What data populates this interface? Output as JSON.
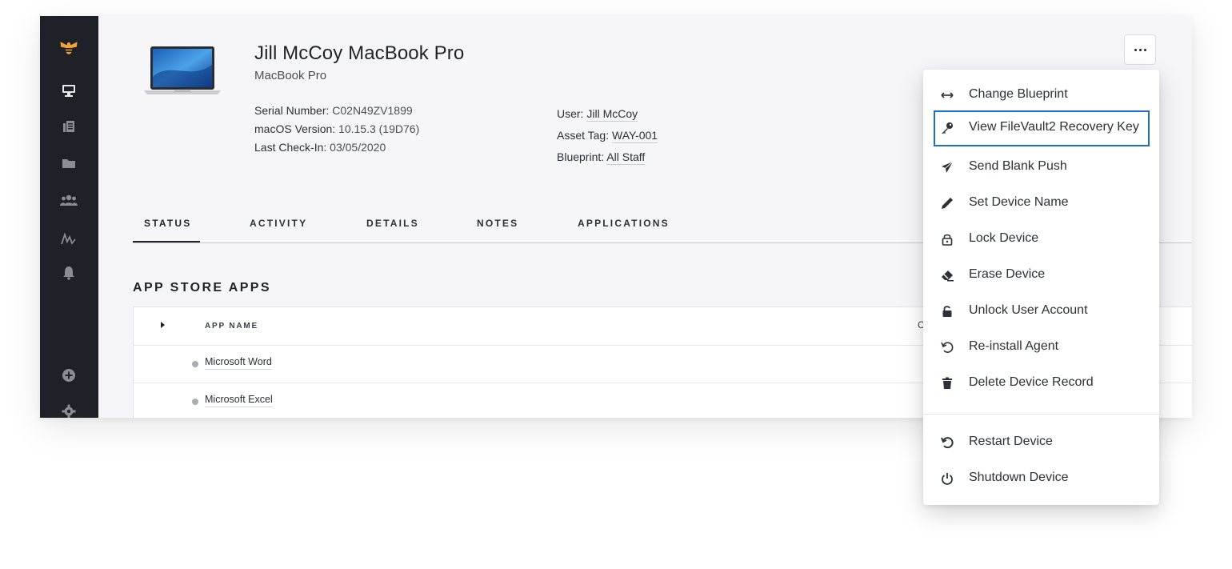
{
  "device": {
    "title": "Jill McCoy MacBook Pro",
    "model": "MacBook Pro",
    "serial_label": "Serial Number:",
    "serial_value": "C02N49ZV1899",
    "macos_label": "macOS Version:",
    "macos_value": "10.15.3 (19D76)",
    "checkin_label": "Last Check-In:",
    "checkin_value": "03/05/2020",
    "user_label": "User:",
    "user_value": "Jill McCoy",
    "asset_label": "Asset Tag:",
    "asset_value": "WAY-001",
    "blueprint_label": "Blueprint:",
    "blueprint_value": "All Staff"
  },
  "tabs": [
    {
      "label": "STATUS",
      "active": true
    },
    {
      "label": "ACTIVITY",
      "active": false
    },
    {
      "label": "DETAILS",
      "active": false
    },
    {
      "label": "NOTES",
      "active": false
    },
    {
      "label": "APPLICATIONS",
      "active": false
    }
  ],
  "section_title": "APP STORE APPS",
  "table": {
    "col_app_name": "APP NAME",
    "col_right_partial": "C",
    "rows": [
      {
        "name": "Microsoft Word"
      },
      {
        "name": "Microsoft Excel"
      }
    ]
  },
  "menu": {
    "items": [
      {
        "label": "Change Blueprint",
        "icon": "arrows-horizontal-icon"
      },
      {
        "label": "View FileVault2 Recovery Key",
        "icon": "key-icon",
        "focused": true
      },
      {
        "label": "Send Blank Push",
        "icon": "paper-plane-icon"
      },
      {
        "label": "Set Device Name",
        "icon": "pencil-icon"
      },
      {
        "label": "Lock Device",
        "icon": "lock-icon"
      },
      {
        "label": "Erase Device",
        "icon": "eraser-icon"
      },
      {
        "label": "Unlock User Account",
        "icon": "unlock-icon"
      },
      {
        "label": "Re-install Agent",
        "icon": "undo-icon"
      },
      {
        "label": "Delete Device Record",
        "icon": "trash-icon"
      },
      {
        "label": "Restart Device",
        "icon": "restart-icon"
      },
      {
        "label": "Shutdown Device",
        "icon": "power-icon"
      }
    ]
  },
  "colors": {
    "sidebar_bg": "#1e2127",
    "brand_accent": "#f2a23c",
    "focus_outline": "#1c6fc1",
    "page_bg": "#f6f6f8"
  }
}
